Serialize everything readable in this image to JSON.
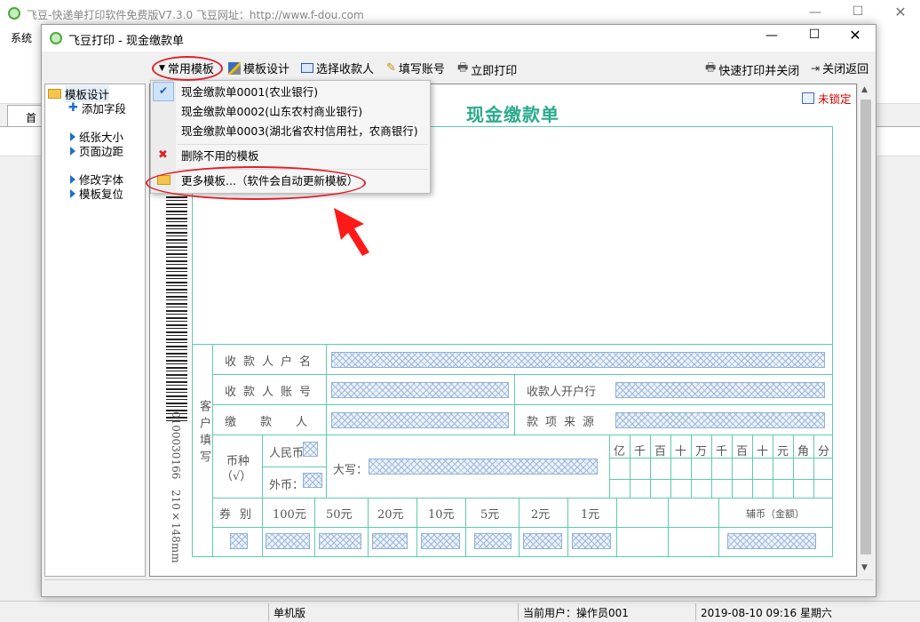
{
  "outer": {
    "title": "飞豆-快递单打印软件免费版V7.3.0  飞豆网址：http://www.f-dou.com",
    "menu_system": "系统",
    "tab_home": "首页"
  },
  "status": {
    "mode": "单机版",
    "user": "当前用户：操作员001",
    "datetime": "2019-08-10 09:16 星期六"
  },
  "dialog": {
    "title": "飞豆打印 - 现金缴款单",
    "toolbar": {
      "common_templates": "常用模板",
      "template_design": "模板设计",
      "select_payee": "选择收款人",
      "fill_account": "填写账号",
      "print_now": "立即打印",
      "quick_print_close": "快速打印并关闭",
      "close_return": "关闭返回"
    },
    "tree": {
      "root": "模板设计",
      "items": [
        "添加字段",
        "纸张大小",
        "页面边距",
        "修改字体",
        "模板复位"
      ]
    },
    "dropdown": {
      "items": [
        "现金缴款单0001(农业银行)",
        "现金缴款单0002(山东农村商业银行)",
        "现金缴款单0003(湖北省农村信用社，农商银行)"
      ],
      "delete_unused": "删除不用的模板",
      "more_templates": "更多模板...（软件会自动更新模板）"
    }
  },
  "form": {
    "title": "现金缴款单",
    "unlocked": "未锁定",
    "side_code": "0100030166",
    "side_size": "210×148mm",
    "customer_fill": "客户填写",
    "payee_name": "收款人户名",
    "payee_account": "收款人账号",
    "payee_bank": "收款人开户行",
    "payer": "缴款人",
    "source": "款项来源",
    "currency": "币种",
    "currency_tick": "（√）",
    "rmb": "人民币",
    "foreign": "外币：",
    "daxie": "大写：",
    "digits": [
      "亿",
      "千",
      "百",
      "十",
      "万",
      "千",
      "百",
      "十",
      "元",
      "角",
      "分"
    ],
    "denom_label": "券别",
    "denoms": [
      "100元",
      "50元",
      "20元",
      "10元",
      "5元",
      "2元",
      "1元"
    ],
    "aux_coin": "辅币（金额）"
  }
}
